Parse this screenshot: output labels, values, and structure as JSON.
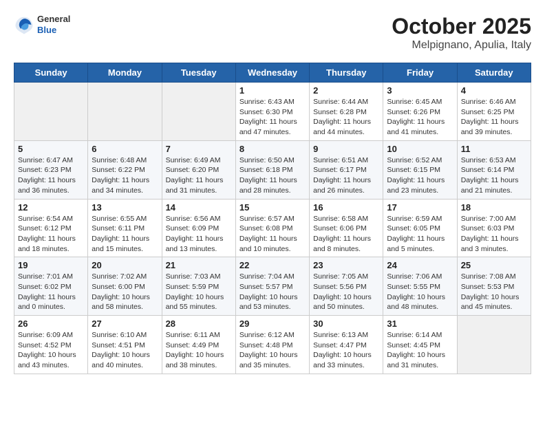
{
  "header": {
    "logo": {
      "general": "General",
      "blue": "Blue"
    },
    "title": "October 2025",
    "subtitle": "Melpignano, Apulia, Italy"
  },
  "weekdays": [
    "Sunday",
    "Monday",
    "Tuesday",
    "Wednesday",
    "Thursday",
    "Friday",
    "Saturday"
  ],
  "weeks": [
    [
      {
        "day": "",
        "info": ""
      },
      {
        "day": "",
        "info": ""
      },
      {
        "day": "",
        "info": ""
      },
      {
        "day": "1",
        "info": "Sunrise: 6:43 AM\nSunset: 6:30 PM\nDaylight: 11 hours\nand 47 minutes."
      },
      {
        "day": "2",
        "info": "Sunrise: 6:44 AM\nSunset: 6:28 PM\nDaylight: 11 hours\nand 44 minutes."
      },
      {
        "day": "3",
        "info": "Sunrise: 6:45 AM\nSunset: 6:26 PM\nDaylight: 11 hours\nand 41 minutes."
      },
      {
        "day": "4",
        "info": "Sunrise: 6:46 AM\nSunset: 6:25 PM\nDaylight: 11 hours\nand 39 minutes."
      }
    ],
    [
      {
        "day": "5",
        "info": "Sunrise: 6:47 AM\nSunset: 6:23 PM\nDaylight: 11 hours\nand 36 minutes."
      },
      {
        "day": "6",
        "info": "Sunrise: 6:48 AM\nSunset: 6:22 PM\nDaylight: 11 hours\nand 34 minutes."
      },
      {
        "day": "7",
        "info": "Sunrise: 6:49 AM\nSunset: 6:20 PM\nDaylight: 11 hours\nand 31 minutes."
      },
      {
        "day": "8",
        "info": "Sunrise: 6:50 AM\nSunset: 6:18 PM\nDaylight: 11 hours\nand 28 minutes."
      },
      {
        "day": "9",
        "info": "Sunrise: 6:51 AM\nSunset: 6:17 PM\nDaylight: 11 hours\nand 26 minutes."
      },
      {
        "day": "10",
        "info": "Sunrise: 6:52 AM\nSunset: 6:15 PM\nDaylight: 11 hours\nand 23 minutes."
      },
      {
        "day": "11",
        "info": "Sunrise: 6:53 AM\nSunset: 6:14 PM\nDaylight: 11 hours\nand 21 minutes."
      }
    ],
    [
      {
        "day": "12",
        "info": "Sunrise: 6:54 AM\nSunset: 6:12 PM\nDaylight: 11 hours\nand 18 minutes."
      },
      {
        "day": "13",
        "info": "Sunrise: 6:55 AM\nSunset: 6:11 PM\nDaylight: 11 hours\nand 15 minutes."
      },
      {
        "day": "14",
        "info": "Sunrise: 6:56 AM\nSunset: 6:09 PM\nDaylight: 11 hours\nand 13 minutes."
      },
      {
        "day": "15",
        "info": "Sunrise: 6:57 AM\nSunset: 6:08 PM\nDaylight: 11 hours\nand 10 minutes."
      },
      {
        "day": "16",
        "info": "Sunrise: 6:58 AM\nSunset: 6:06 PM\nDaylight: 11 hours\nand 8 minutes."
      },
      {
        "day": "17",
        "info": "Sunrise: 6:59 AM\nSunset: 6:05 PM\nDaylight: 11 hours\nand 5 minutes."
      },
      {
        "day": "18",
        "info": "Sunrise: 7:00 AM\nSunset: 6:03 PM\nDaylight: 11 hours\nand 3 minutes."
      }
    ],
    [
      {
        "day": "19",
        "info": "Sunrise: 7:01 AM\nSunset: 6:02 PM\nDaylight: 11 hours\nand 0 minutes."
      },
      {
        "day": "20",
        "info": "Sunrise: 7:02 AM\nSunset: 6:00 PM\nDaylight: 10 hours\nand 58 minutes."
      },
      {
        "day": "21",
        "info": "Sunrise: 7:03 AM\nSunset: 5:59 PM\nDaylight: 10 hours\nand 55 minutes."
      },
      {
        "day": "22",
        "info": "Sunrise: 7:04 AM\nSunset: 5:57 PM\nDaylight: 10 hours\nand 53 minutes."
      },
      {
        "day": "23",
        "info": "Sunrise: 7:05 AM\nSunset: 5:56 PM\nDaylight: 10 hours\nand 50 minutes."
      },
      {
        "day": "24",
        "info": "Sunrise: 7:06 AM\nSunset: 5:55 PM\nDaylight: 10 hours\nand 48 minutes."
      },
      {
        "day": "25",
        "info": "Sunrise: 7:08 AM\nSunset: 5:53 PM\nDaylight: 10 hours\nand 45 minutes."
      }
    ],
    [
      {
        "day": "26",
        "info": "Sunrise: 6:09 AM\nSunset: 4:52 PM\nDaylight: 10 hours\nand 43 minutes."
      },
      {
        "day": "27",
        "info": "Sunrise: 6:10 AM\nSunset: 4:51 PM\nDaylight: 10 hours\nand 40 minutes."
      },
      {
        "day": "28",
        "info": "Sunrise: 6:11 AM\nSunset: 4:49 PM\nDaylight: 10 hours\nand 38 minutes."
      },
      {
        "day": "29",
        "info": "Sunrise: 6:12 AM\nSunset: 4:48 PM\nDaylight: 10 hours\nand 35 minutes."
      },
      {
        "day": "30",
        "info": "Sunrise: 6:13 AM\nSunset: 4:47 PM\nDaylight: 10 hours\nand 33 minutes."
      },
      {
        "day": "31",
        "info": "Sunrise: 6:14 AM\nSunset: 4:45 PM\nDaylight: 10 hours\nand 31 minutes."
      },
      {
        "day": "",
        "info": ""
      }
    ]
  ]
}
